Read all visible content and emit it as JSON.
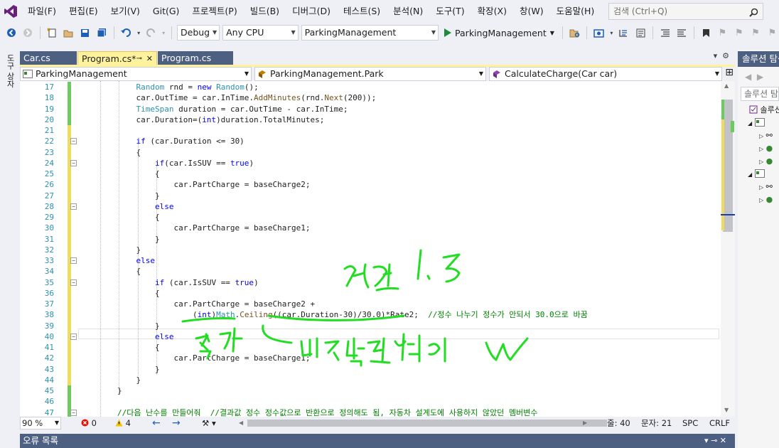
{
  "menu": [
    "파일(F)",
    "편집(E)",
    "보기(V)",
    "Git(G)",
    "프로젝트(P)",
    "빌드(B)",
    "디버그(D)",
    "테스트(S)",
    "분석(N)",
    "도구(T)",
    "확장(X)",
    "창(W)",
    "도움말(H)"
  ],
  "search": {
    "placeholder": "검색 (Ctrl+Q)"
  },
  "toolbar": {
    "config": "Debug",
    "platform": "Any CPU",
    "startup_project": "ParkingManagement",
    "run_label": "ParkingManagement"
  },
  "left_rail": {
    "label": "도구 상자"
  },
  "tabs": [
    {
      "label": "Car.cs",
      "active": false
    },
    {
      "label": "Program.cs*",
      "active": true
    },
    {
      "label": "Program.cs",
      "active": false
    }
  ],
  "nav": {
    "project": "ParkingManagement",
    "type": "ParkingManagement.Park",
    "member": "CalculateCharge(Car car)"
  },
  "code_lines": [
    {
      "n": "17",
      "text": "            Random rnd = new Random();"
    },
    {
      "n": "18",
      "text": "            car.OutTime = car.InTime.AddMinutes(rnd.Next(200));"
    },
    {
      "n": "19",
      "text": "            TimeSpan duration = car.OutTime - car.InTime;"
    },
    {
      "n": "20",
      "text": "            car.Duration=(int)duration.TotalMinutes;"
    },
    {
      "n": "21",
      "text": ""
    },
    {
      "n": "22",
      "text": "            if (car.Duration <= 30)"
    },
    {
      "n": "23",
      "text": "            {"
    },
    {
      "n": "24",
      "text": "                if(car.IsSUV == true)"
    },
    {
      "n": "25",
      "text": "                {"
    },
    {
      "n": "26",
      "text": "                    car.PartCharge = baseCharge2;"
    },
    {
      "n": "27",
      "text": "                }"
    },
    {
      "n": "28",
      "text": "                else"
    },
    {
      "n": "29",
      "text": "                {"
    },
    {
      "n": "30",
      "text": "                    car.PartCharge = baseCharge1;"
    },
    {
      "n": "31",
      "text": "                }"
    },
    {
      "n": "32",
      "text": "            }"
    },
    {
      "n": "33",
      "text": "            else"
    },
    {
      "n": "34",
      "text": "            {"
    },
    {
      "n": "35",
      "text": "                if (car.IsSUV == true)"
    },
    {
      "n": "36",
      "text": "                {"
    },
    {
      "n": "37",
      "text": "                    car.PartCharge = baseCharge2 +"
    },
    {
      "n": "38",
      "text": "                        (int)Math.Ceiling((car.Duration-30)/30.0)*Rate2;  //정수 나누기 정수가 안되서 30.0으로 바꿈"
    },
    {
      "n": "39",
      "text": "                }"
    },
    {
      "n": "40",
      "text": "                else"
    },
    {
      "n": "41",
      "text": "                {"
    },
    {
      "n": "42",
      "text": "                    car.PartCharge = baseCharge1;"
    },
    {
      "n": "43",
      "text": "                }"
    },
    {
      "n": "44",
      "text": "            }"
    },
    {
      "n": "45",
      "text": "        }"
    },
    {
      "n": "46",
      "text": ""
    },
    {
      "n": "47",
      "text": "        //다음 난수를 만들어줘  //결과값 정수 정수값으로 반환으로 정의해도 됨, 자동차 설계도에 사용하지 않았던 멤버변수"
    }
  ],
  "status": {
    "zoom": "90 %",
    "errors": "0",
    "warnings": "4",
    "line": "줄: 40",
    "col": "문자: 21",
    "spc": "SPC",
    "crlf": "CRLF"
  },
  "error_list": {
    "title": "오류 목록"
  },
  "solution_explorer": {
    "title": "솔루션 탐색기",
    "search": "솔루션 탐색기 검색",
    "root": "솔루션"
  },
  "colors": {
    "accent": "#4d6082",
    "active_tab": "#fff29d",
    "keyword": "#0000ff",
    "type": "#2b91af",
    "comment": "#008000",
    "ink": "#22dd22"
  }
}
